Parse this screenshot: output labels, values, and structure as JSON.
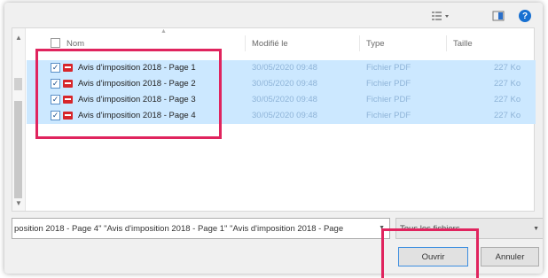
{
  "toolbar": {
    "view_icon": "view-menu-icon",
    "preview_pane_icon": "preview-pane-icon",
    "help_icon": "help-icon",
    "help_glyph": "?"
  },
  "columns": {
    "name": "Nom",
    "modified": "Modifié le",
    "type": "Type",
    "size": "Taille"
  },
  "files": [
    {
      "name": "Avis d'imposition 2018 - Page 1",
      "modified": "30/05/2020 09:48",
      "type": "Fichier PDF",
      "size": "227 Ko",
      "checked": true
    },
    {
      "name": "Avis d'imposition 2018 - Page 2",
      "modified": "30/05/2020 09:48",
      "type": "Fichier PDF",
      "size": "227 Ko",
      "checked": true
    },
    {
      "name": "Avis d'imposition 2018 - Page 3",
      "modified": "30/05/2020 09:48",
      "type": "Fichier PDF",
      "size": "227 Ko",
      "checked": true
    },
    {
      "name": "Avis d'imposition 2018 - Page 4",
      "modified": "30/05/2020 09:48",
      "type": "Fichier PDF",
      "size": "227 Ko",
      "checked": true
    }
  ],
  "filename": {
    "value": "position 2018 - Page 4\" \"Avis d'imposition 2018 - Page 1\" \"Avis d'imposition 2018 - Page"
  },
  "file_type": {
    "selected": "Tous les fichiers"
  },
  "buttons": {
    "open": "Ouvrir",
    "cancel": "Annuler"
  },
  "colors": {
    "selection": "#cce8ff",
    "highlight": "#e0245e",
    "pdf_icon": "#d7262b",
    "help": "#1870d1"
  }
}
